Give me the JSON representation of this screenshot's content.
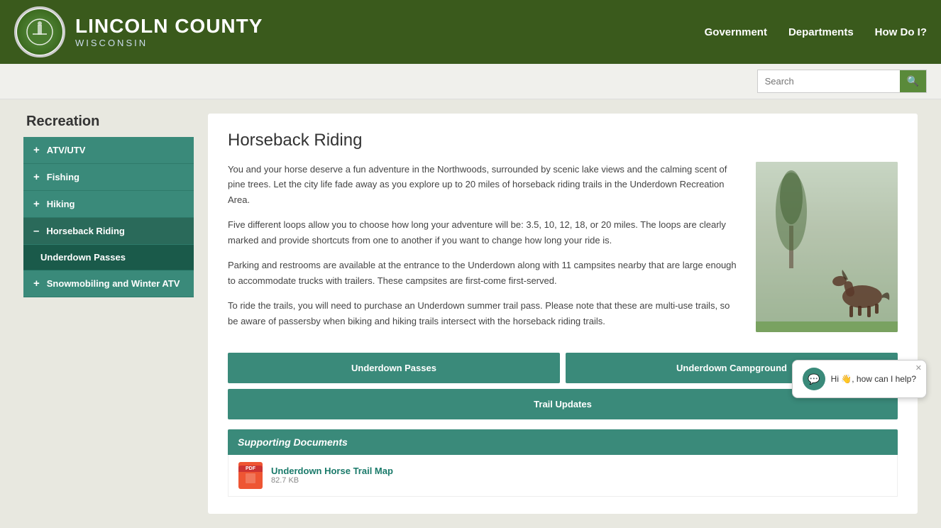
{
  "header": {
    "county": "LINCOLN COUNTY",
    "state": "WISCONSIN",
    "nav": {
      "government": "Government",
      "departments": "Departments",
      "how_do_i": "How Do I?"
    }
  },
  "search": {
    "placeholder": "Search",
    "button_label": "🔍"
  },
  "sidebar": {
    "title": "Recreation",
    "items": [
      {
        "label": "ATV/UTV",
        "icon": "+",
        "active": false
      },
      {
        "label": "Fishing",
        "icon": "+",
        "active": false
      },
      {
        "label": "Hiking",
        "icon": "+",
        "active": false
      },
      {
        "label": "Horseback Riding",
        "icon": "–",
        "active": true
      },
      {
        "label": "Underdown Passes",
        "sub": true,
        "active": true
      },
      {
        "label": "Snowmobiling and Winter ATV",
        "icon": "+",
        "active": false
      }
    ]
  },
  "main": {
    "title": "Horseback Riding",
    "paragraphs": [
      "You and your horse deserve a fun adventure in the Northwoods, surrounded by scenic lake views and the calming scent of pine trees. Let the city life fade away as you explore up to 20 miles of horseback riding trails in the Underdown Recreation Area.",
      "Five different loops allow you to choose how long your adventure will be: 3.5, 10, 12, 18, or 20 miles.  The loops are clearly marked and provide shortcuts from one to another if you want to change how long your ride is.",
      "Parking and restrooms are available at the entrance to the Underdown along with 11 campsites nearby that are large enough to accommodate trucks with trailers.  These campsites are first-come first-served.",
      "To ride the trails, you will need to purchase an Underdown summer trail pass. Please note that these are multi-use trails, so be aware of passersby when biking and hiking trails intersect with the horseback riding trails."
    ],
    "buttons": {
      "underdown_passes": "Underdown Passes",
      "underdown_campground": "Underdown Campground",
      "trail_updates": "Trail Updates"
    },
    "supporting_docs": {
      "header": "Supporting Documents",
      "documents": [
        {
          "name": "Underdown Horse Trail Map",
          "size": "82.7 KB",
          "type": "PDF"
        }
      ]
    }
  },
  "chat": {
    "message": "Hi 👋, how can I help?"
  }
}
